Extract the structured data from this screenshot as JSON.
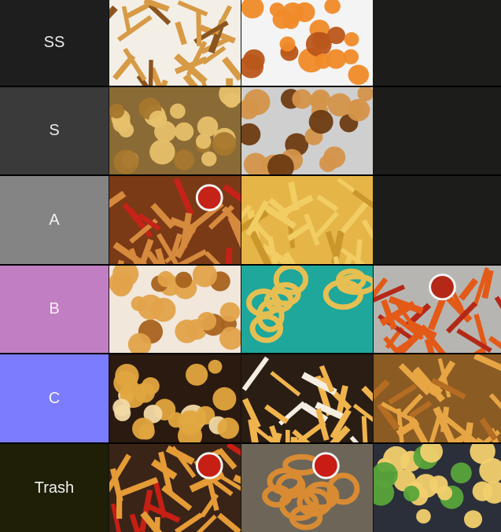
{
  "tiers": [
    {
      "label": "SS",
      "color": "#1e1e1e",
      "text_color": "#ececec",
      "items": [
        {
          "name": "shoestring-fries",
          "bg": "#f3efe7",
          "food": "#d79a45",
          "accent": "#8c5520"
        },
        {
          "name": "waffle-fries",
          "bg": "#f4f4f4",
          "food": "#f08a28",
          "accent": "#b9561a"
        }
      ]
    },
    {
      "label": "S",
      "color": "#3a3a3a",
      "text_color": "#ececec",
      "items": [
        {
          "name": "roasted-potatoes",
          "bg": "#8a6a35",
          "food": "#e6c06a",
          "accent": "#a7772e"
        },
        {
          "name": "smiley-fries",
          "bg": "#cfcfcf",
          "food": "#d4944a",
          "accent": "#6e3b12"
        }
      ]
    },
    {
      "label": "A",
      "color": "#848484",
      "text_color": "#f3f3f3",
      "items": [
        {
          "name": "potato-wedges",
          "bg": "#7a3a16",
          "food": "#d58a3d",
          "accent": "#c52218"
        },
        {
          "name": "french-fries",
          "bg": "#e5b548",
          "food": "#f1cd63",
          "accent": "#c9972c"
        }
      ]
    },
    {
      "label": "B",
      "color": "#c27ec2",
      "text_color": "#f6eef6",
      "items": [
        {
          "name": "tater-tots",
          "bg": "#f1e7db",
          "food": "#e2a24a",
          "accent": "#a8621e"
        },
        {
          "name": "spiral-potatoes",
          "bg": "#1ea79a",
          "food": "#e6bf52",
          "accent": "#8b5d1b"
        },
        {
          "name": "sweet-potato-fries",
          "bg": "#b7b5b1",
          "food": "#e35a18",
          "accent": "#b42817"
        }
      ]
    },
    {
      "label": "C",
      "color": "#7c7cff",
      "text_color": "#f7f7ff",
      "items": [
        {
          "name": "chips",
          "bg": "#2b1a10",
          "food": "#e2a53f",
          "accent": "#f2d9a6"
        },
        {
          "name": "steak-fries",
          "bg": "#2a1d14",
          "food": "#f0b44d",
          "accent": "#f4eee2"
        },
        {
          "name": "crinkle-cut-fries",
          "bg": "#8a5b23",
          "food": "#e8a544",
          "accent": "#b46d22"
        }
      ]
    },
    {
      "label": "Trash",
      "color": "#1f1e07",
      "text_color": "#f1f1f1",
      "items": [
        {
          "name": "thick-cut-fries",
          "bg": "#3a2418",
          "food": "#e59b36",
          "accent": "#c71f14"
        },
        {
          "name": "curly-fries",
          "bg": "#6d6658",
          "food": "#d98b33",
          "accent": "#c81c15"
        },
        {
          "name": "fish-and-chips",
          "bg": "#2b2f39",
          "food": "#f2d06e",
          "accent": "#59a43a"
        }
      ]
    }
  ]
}
